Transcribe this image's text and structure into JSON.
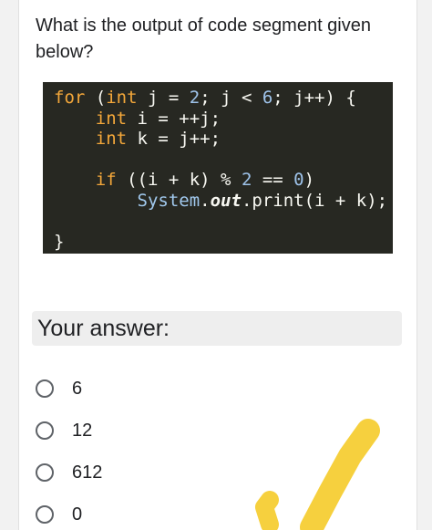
{
  "question": {
    "text": "What is the output of code segment given below?"
  },
  "code": {
    "line1": {
      "kw_for": "for",
      "a": " (",
      "kw_int": "int",
      "b": " j = ",
      "n2": "2",
      "c": "; j < ",
      "n6": "6",
      "d": "; j++) {"
    },
    "line2": {
      "indent": "    ",
      "kw_int": "int",
      "rest": " i = ++j;"
    },
    "line3": {
      "indent": "    ",
      "kw_int": "int",
      "rest": " k = j++;"
    },
    "line5": {
      "indent": "    ",
      "kw_if": "if",
      "a": " ((i + k) % ",
      "n2": "2",
      "b": " == ",
      "n0": "0",
      "c": ")"
    },
    "line6": {
      "indent": "        ",
      "cls": "System",
      "dot1": ".",
      "fld": "out",
      "rest": ".print(i + k);"
    },
    "line7": {
      "brace": "}"
    }
  },
  "answer": {
    "label": "Your answer:"
  },
  "options": [
    {
      "label": "6"
    },
    {
      "label": "12"
    },
    {
      "label": "612"
    },
    {
      "label": "0"
    }
  ],
  "colors": {
    "code_background": "#272822",
    "keyword": "#f3a73a",
    "number": "#9ec3ea",
    "highlighter": "#f5cc2e"
  }
}
